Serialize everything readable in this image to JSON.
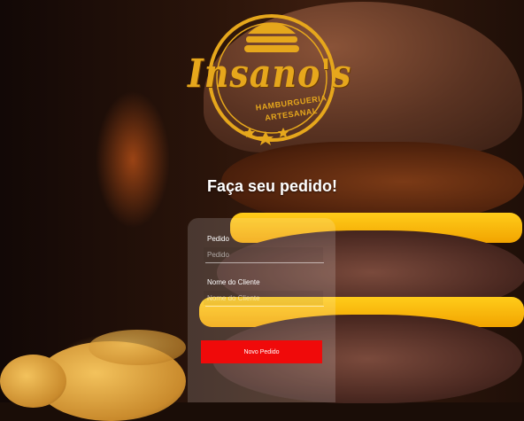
{
  "brand": {
    "name": "Insano's",
    "tagline_1": "HAMBURGUERIA",
    "tagline_2": "ARTESANAL"
  },
  "form": {
    "heading": "Faça seu pedido!",
    "order": {
      "label": "Pedido",
      "placeholder": "Pedido"
    },
    "customer": {
      "label": "Nome do Cliente",
      "placeholder": "Nome do Cliente"
    },
    "submit_label": "Novo Pedido"
  },
  "colors": {
    "accent": "#f00a0a",
    "logo": "#e6a71c"
  }
}
